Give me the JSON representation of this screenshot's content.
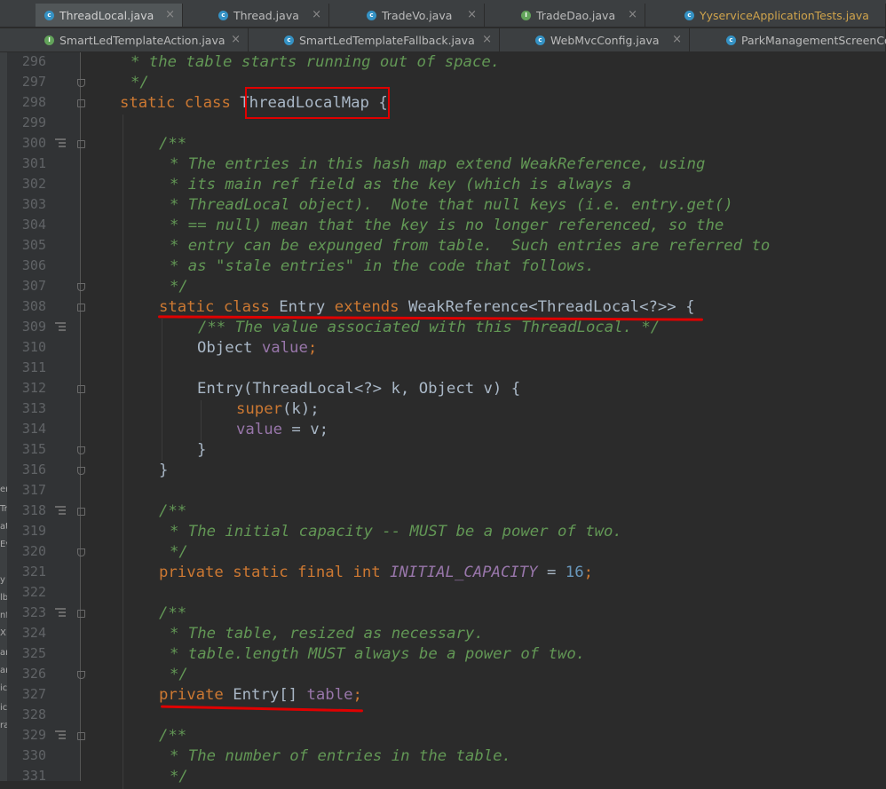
{
  "tabs_row1": [
    {
      "label": "ThreadLocal.java",
      "icon": "class-icon",
      "active": true
    },
    {
      "label": "Thread.java",
      "icon": "class-icon",
      "active": false
    },
    {
      "label": "TradeVo.java",
      "icon": "class-icon",
      "active": false
    },
    {
      "label": "TradeDao.java",
      "icon": "interface-icon",
      "active": false
    },
    {
      "label": "YyserviceApplicationTests.java",
      "icon": "test-class-icon",
      "active": false
    }
  ],
  "tabs_row2": [
    {
      "label": "SmartLedTemplateAction.java",
      "icon": "interface-icon",
      "active": false
    },
    {
      "label": "SmartLedTemplateFallback.java",
      "icon": "class-icon",
      "active": false
    },
    {
      "label": "WebMvcConfig.java",
      "icon": "class-icon",
      "active": false
    },
    {
      "label": "ParkManagementScreenCont",
      "icon": "class-icon",
      "active": false
    }
  ],
  "close_glyph": "×",
  "side_fragments": [
    "er",
    "Tr",
    "at",
    "Ev",
    "y",
    "lb",
    "nf",
    "X",
    "ar",
    "ar",
    "ic",
    "ic",
    "ra"
  ],
  "colors": {
    "keyword": "#cc7832",
    "comment": "#629755",
    "field": "#9876aa",
    "number": "#6897bb",
    "text": "#a9b7c6",
    "highlight": "#e00000"
  },
  "line_numbers": [
    "296",
    "297",
    "298",
    "299",
    "300",
    "301",
    "302",
    "303",
    "304",
    "305",
    "306",
    "307",
    "308",
    "309",
    "310",
    "311",
    "312",
    "313",
    "314",
    "315",
    "316",
    "317",
    "318",
    "319",
    "320",
    "321",
    "322",
    "323",
    "324",
    "325",
    "326",
    "327",
    "328",
    "329",
    "330",
    "331"
  ],
  "code": {
    "l296": "* the table starts running out of space.",
    "l297": "*/",
    "l298_kw1": "static",
    "l298_kw2": "class",
    "l298_name": "ThreadLocalMap",
    "l298_brace": "{",
    "l300": "/**",
    "l301": "* The entries in this hash map extend WeakReference, using",
    "l302": "* its main ref field as the key (which is always a",
    "l303": "* ThreadLocal object).  Note that null keys (i.e. entry.get()",
    "l304": "* == null) mean that the key is no longer referenced, so the",
    "l305": "* entry can be expunged from table.  Such entries are referred to",
    "l306": "* as \"stale entries\" in the code that follows.",
    "l307": "*/",
    "l308_kw1": "static",
    "l308_kw2": "class",
    "l308_name": "Entry",
    "l308_kw3": "extends",
    "l308_rest": "WeakReference<ThreadLocal<?>> {",
    "l309": "/** The value associated with this ThreadLocal. */",
    "l310_type": "Object",
    "l310_field": "value",
    "l310_semi": ";",
    "l312": "Entry(ThreadLocal<?> k, Object v) {",
    "l313_kw": "super",
    "l313_rest": "(k);",
    "l314_field": "value",
    "l314_rest": " = v;",
    "l315": "}",
    "l316": "}",
    "l318": "/**",
    "l319": "* The initial capacity -- MUST be a power of two.",
    "l320": "*/",
    "l321_kw": "private static final int",
    "l321_const": "INITIAL_CAPACITY",
    "l321_eq": " = ",
    "l321_num": "16",
    "l321_semi": ";",
    "l323": "/**",
    "l324": "* The table, resized as necessary.",
    "l325": "* table.length MUST always be a power of two.",
    "l326": "*/",
    "l327_kw": "private",
    "l327_type": "Entry[]",
    "l327_field": "table",
    "l327_semi": ";",
    "l329": "/**",
    "l330": "* The number of entries in the table.",
    "l331": "*/"
  }
}
